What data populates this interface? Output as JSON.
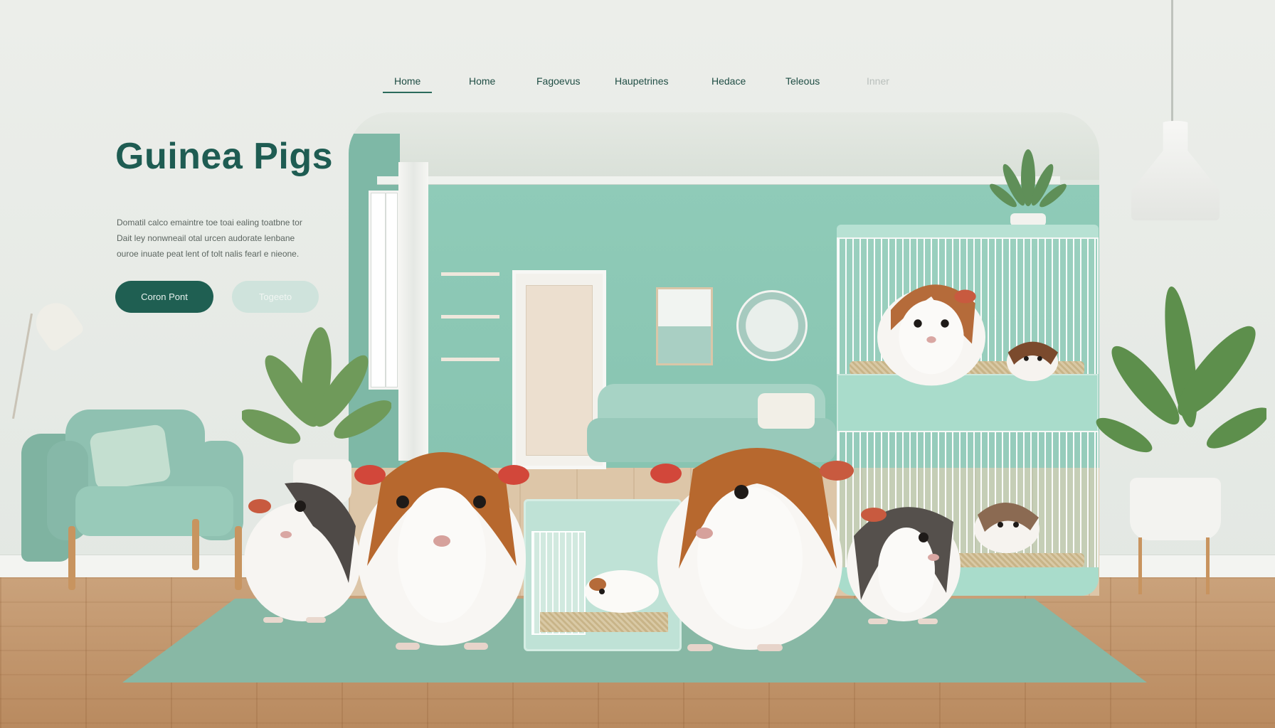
{
  "nav": {
    "brand": "",
    "items": [
      {
        "label": "Home",
        "active": true
      },
      {
        "label": "Home",
        "active": false
      },
      {
        "label": "Fagoevus",
        "active": false
      },
      {
        "label": "Haupetrines",
        "active": false
      },
      {
        "label": "Hedace",
        "active": false
      },
      {
        "label": "Teleous",
        "active": false
      },
      {
        "label": "Inner",
        "active": false,
        "dim": true
      }
    ]
  },
  "hero": {
    "title": "Guinea Pigs",
    "kicker": "",
    "description": [
      "Domatil calco emaintre toe toai ealing toatbne tor",
      "Dait ley nonwneail otal urcen audorate lenbane",
      "ouroe inuate peat lent of tolt nalis fearl e nieone."
    ],
    "primary_button": "Coron Pont",
    "secondary_button": "Togeeto"
  },
  "colors": {
    "accent": "#1f5f52",
    "mint_wall": "#8fcbb8",
    "cage": "#a9dccb",
    "rug": "#88b8a5",
    "floor": "#c49a72"
  },
  "icons": [
    "plant-icon",
    "lamp-icon",
    "pendant-lamp-icon",
    "guinea-pig-icon"
  ]
}
